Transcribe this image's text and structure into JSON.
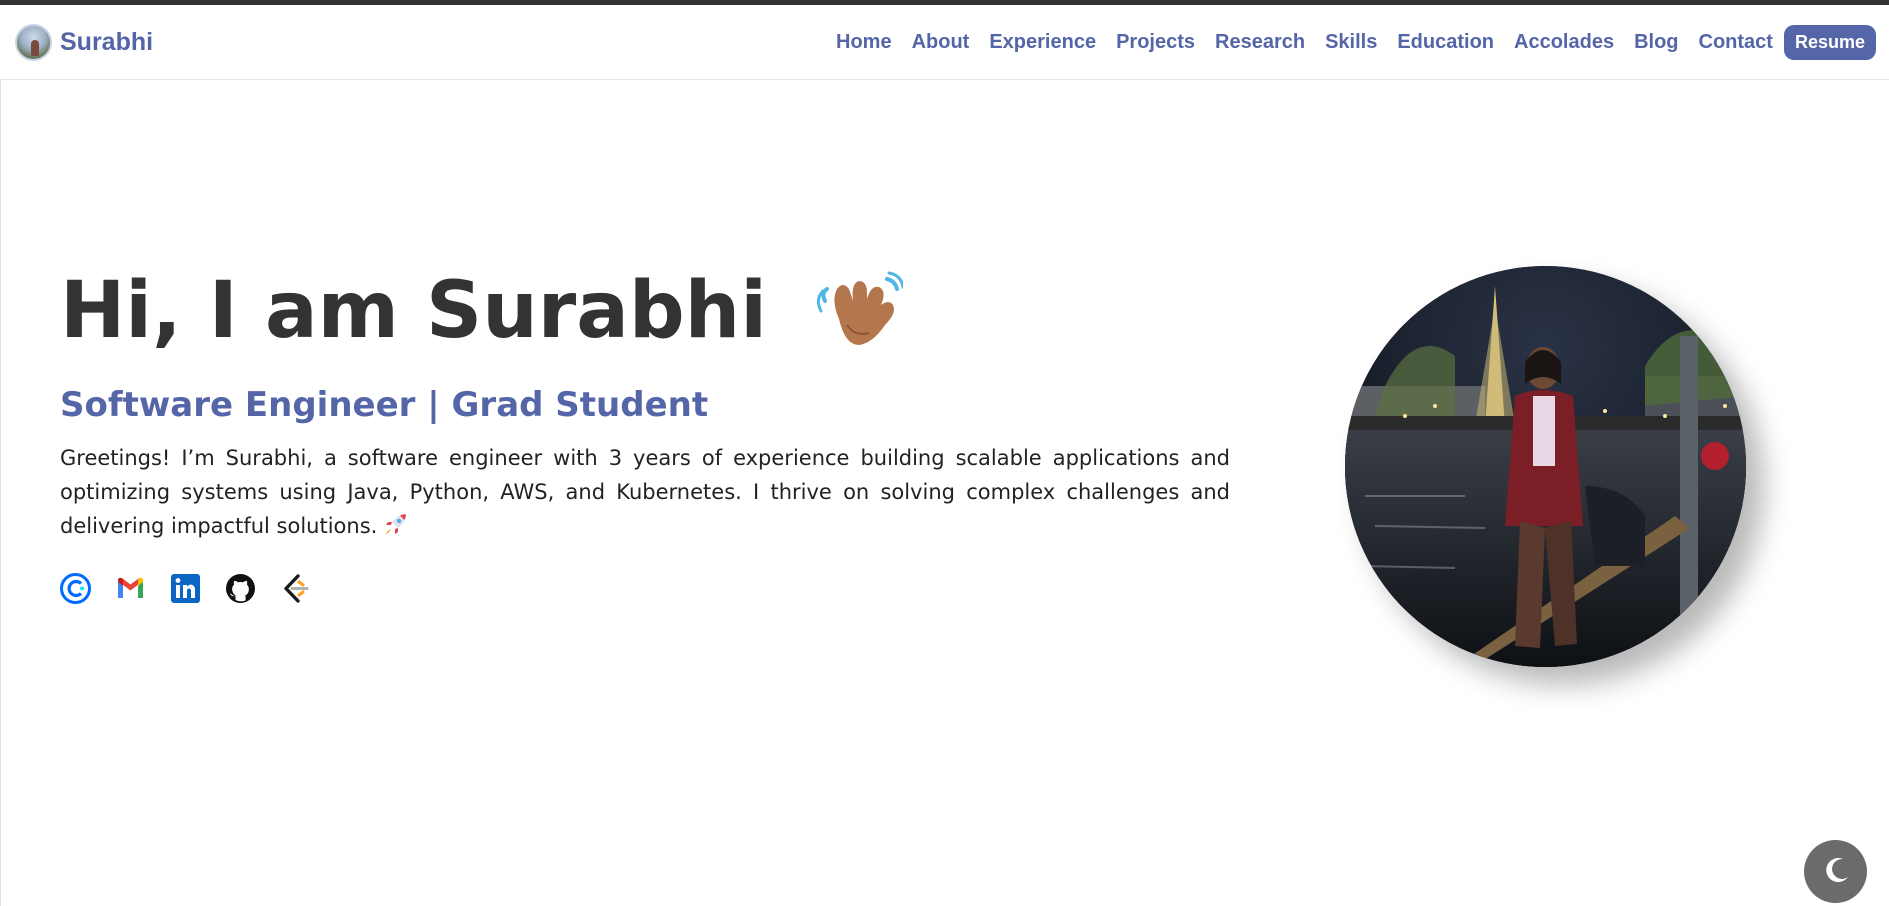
{
  "brand": {
    "name": "Surabhi"
  },
  "nav": {
    "items": [
      {
        "label": "Home"
      },
      {
        "label": "About"
      },
      {
        "label": "Experience"
      },
      {
        "label": "Projects"
      },
      {
        "label": "Research"
      },
      {
        "label": "Skills"
      },
      {
        "label": "Education"
      },
      {
        "label": "Accolades"
      },
      {
        "label": "Blog"
      },
      {
        "label": "Contact"
      }
    ],
    "resume_label": "Resume"
  },
  "hero": {
    "title": "Hi, I am Surabhi",
    "subtitle": "Software Engineer | Grad Student",
    "description": "Greetings! I’m Surabhi, a software engineer with 3 years of experience building scalable applications and optimizing systems using Java, Python, AWS, and Kubernetes. I thrive on solving complex challenges and delivering impactful solutions."
  },
  "socials": [
    {
      "icon": "calendly-icon"
    },
    {
      "icon": "gmail-icon"
    },
    {
      "icon": "linkedin-icon"
    },
    {
      "icon": "github-icon"
    },
    {
      "icon": "leetcode-icon"
    }
  ],
  "colors": {
    "accent": "#5566a8",
    "text": "#333333",
    "toggle": "#6b6b6b"
  },
  "theme_toggle": {
    "icon": "moon-icon"
  }
}
